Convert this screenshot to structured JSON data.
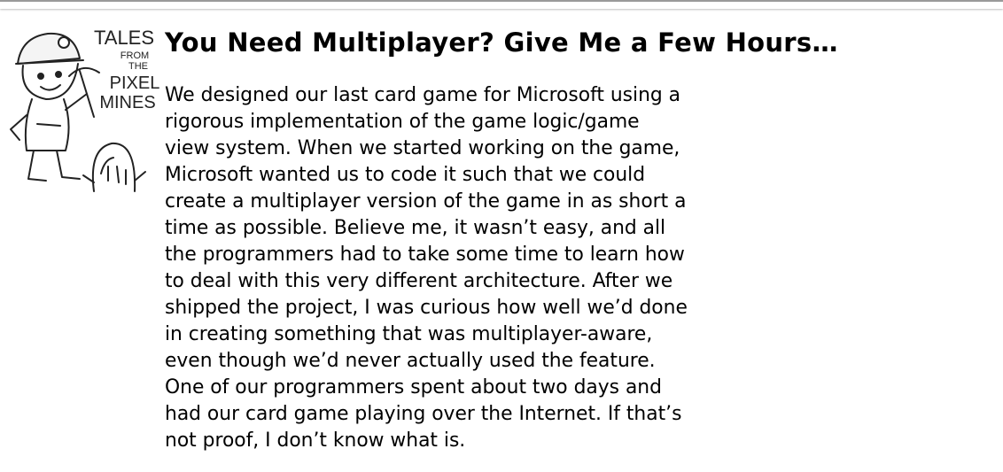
{
  "callout": {
    "emblem_lines": [
      "TALES",
      "FROM",
      "THE",
      "PIXEL",
      "MINES"
    ],
    "title": "You Need Multiplayer? Give Me a Few Hours…",
    "body": "We designed our last card game for Microsoft using a rigorous implementation of the game logic/game view system. When we started working on the game, Microsoft wanted us to code it such that we could create a multiplayer version of the game in as short a time as possible. Believe me, it wasn’t easy, and all the programmers had to take some time to learn how to deal with this very different architecture. After we shipped the project, I was curious how well we’d done in creating something that was multiplayer-aware, even though we’d never actually used the feature. One of our programmers spent about two days and had our card game playing over the Internet. If that’s not proof, I don’t know what is."
  }
}
